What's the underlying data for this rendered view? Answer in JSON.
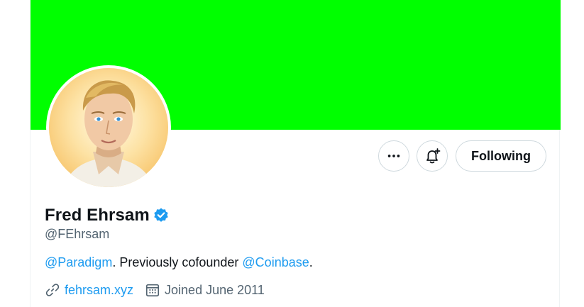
{
  "colors": {
    "banner": "#00ff00",
    "accent": "#1d9bf0",
    "text_primary": "#0f1419",
    "text_secondary": "#536471"
  },
  "profile": {
    "display_name": "Fred Ehrsam",
    "handle": "@FEhrsam",
    "bio": {
      "mention_1": "@Paradigm",
      "text_1": ". Previously cofounder ",
      "mention_2": "@Coinbase",
      "text_2": "."
    },
    "website": "fehrsam.xyz",
    "joined": "Joined June 2011"
  },
  "actions": {
    "more_icon": "ellipsis-icon",
    "notify_icon": "bell-plus-icon",
    "follow_label": "Following"
  },
  "icons": {
    "verified": "verified-badge-icon",
    "link": "link-icon",
    "calendar": "calendar-icon"
  }
}
